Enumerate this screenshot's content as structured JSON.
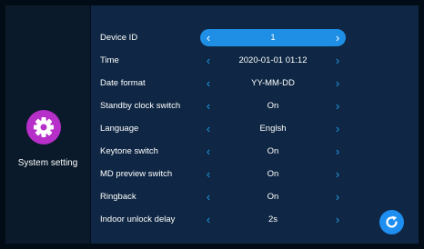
{
  "sidebar": {
    "label": "System setting",
    "icon": "gear-icon",
    "accent": "#b62fc9"
  },
  "settings": [
    {
      "label": "Device ID",
      "value": "1",
      "selected": true
    },
    {
      "label": "Time",
      "value": "2020-01-01 01:12"
    },
    {
      "label": "Date format",
      "value": "YY-MM-DD"
    },
    {
      "label": "Standby clock switch",
      "value": "On"
    },
    {
      "label": "Language",
      "value": "Englsh"
    },
    {
      "label": "Keytone switch",
      "value": "On"
    },
    {
      "label": "MD preview switch",
      "value": "On"
    },
    {
      "label": "Ringback",
      "value": "On"
    },
    {
      "label": "Indoor unlock delay",
      "value": "2s"
    }
  ],
  "arrows": {
    "left": "‹",
    "right": "›"
  },
  "refresh": {
    "icon": "refresh-icon",
    "color": "#1e8ef0"
  },
  "colors": {
    "selected_bg": "#1f8fe6",
    "arrow": "#1e9ae8",
    "panel": "#0f2744"
  }
}
